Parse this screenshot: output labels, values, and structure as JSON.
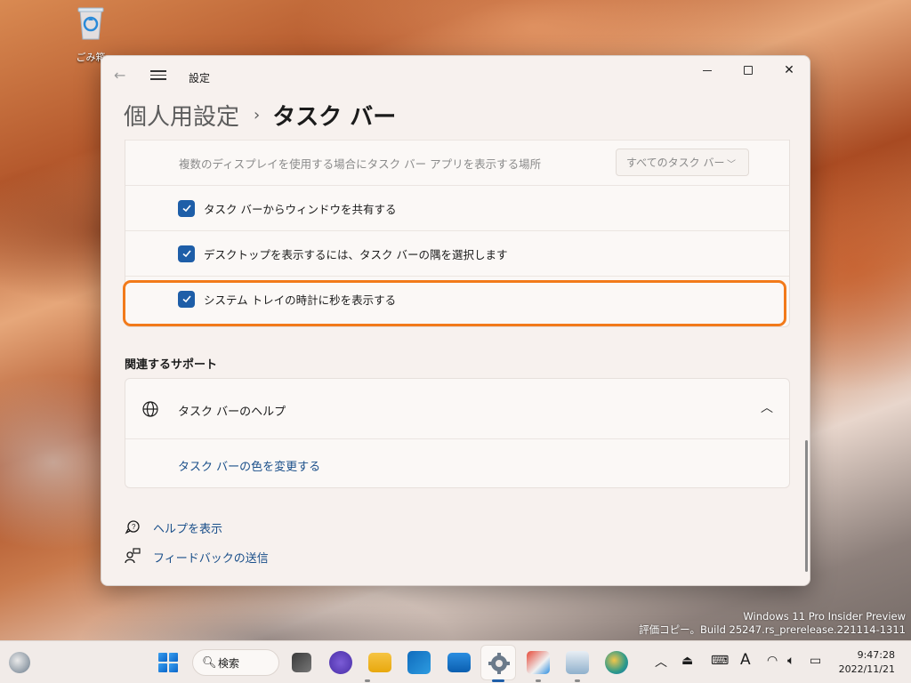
{
  "desktop": {
    "recycle_bin_label": "ごみ箱"
  },
  "watermark": {
    "line1": "Windows 11 Pro Insider Preview",
    "line2": "評価コピー。Build 25247.rs_prerelease.221114-1311"
  },
  "window": {
    "app_title": "設定",
    "breadcrumb": {
      "parent": "個人用設定",
      "separator": "›",
      "current": "タスク バー"
    },
    "settings_rows": [
      {
        "label": "複数のディスプレイを使用する場合にタスク バー アプリを表示する場所",
        "type": "dropdown",
        "enabled": false,
        "dropdown_value": "すべてのタスク バー"
      },
      {
        "label": "タスク バーからウィンドウを共有する",
        "type": "checkbox",
        "checked": true
      },
      {
        "label": "デスクトップを表示するには、タスク バーの隅を選択します",
        "type": "checkbox",
        "checked": true
      },
      {
        "label": "システム トレイの時計に秒を表示する",
        "type": "checkbox",
        "checked": true,
        "highlighted": true
      }
    ],
    "related_support": {
      "heading": "関連するサポート",
      "item_title": "タスク バーのヘルプ",
      "expanded": true,
      "link": "タスク バーの色を変更する"
    },
    "footer": {
      "help": "ヘルプを表示",
      "feedback": "フィードバックの送信"
    }
  },
  "taskbar": {
    "search_label": "検索",
    "pinned_apps": [
      "task-view",
      "teams-chat",
      "file-explorer",
      "microsoft-store",
      "mail",
      "settings",
      "snipping-tool",
      "resource-monitor",
      "edge-canary"
    ],
    "active_app": "settings",
    "tray_icons": [
      "chevron-up-icon",
      "display-icon",
      "keyboard-icon",
      "ime-icon",
      "wifi-icon",
      "volume-icon",
      "battery-icon"
    ],
    "ime_indicator": "A",
    "clock": {
      "time": "9:47:28",
      "date": "2022/11/21"
    }
  },
  "colors": {
    "accent": "#1e5ea8",
    "highlight_border": "#f27a1a",
    "link": "#1a4f8a"
  }
}
